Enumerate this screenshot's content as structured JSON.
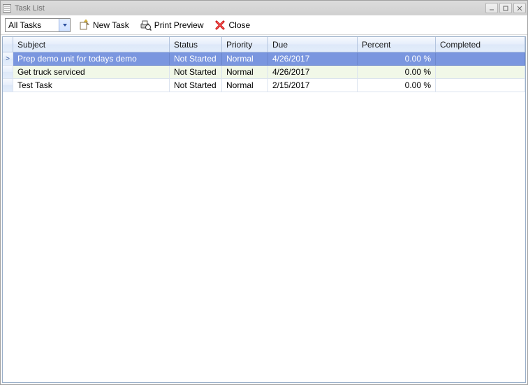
{
  "window": {
    "title": "Task List"
  },
  "toolbar": {
    "filter": "All Tasks",
    "new_task": "New Task",
    "print_preview": "Print Preview",
    "close": "Close"
  },
  "grid": {
    "columns": {
      "subject": "Subject",
      "status": "Status",
      "priority": "Priority",
      "due": "Due",
      "percent": "Percent",
      "completed": "Completed"
    },
    "rows": [
      {
        "indicator": ">",
        "subject": "Prep demo unit for todays demo",
        "status": "Not Started",
        "priority": "Normal",
        "due": "4/26/2017",
        "percent": "0.00 %",
        "completed": "",
        "selected": true
      },
      {
        "indicator": "",
        "subject": "Get truck serviced",
        "status": "Not Started",
        "priority": "Normal",
        "due": "4/26/2017",
        "percent": "0.00 %",
        "completed": "",
        "alt": true
      },
      {
        "indicator": "",
        "subject": "Test Task",
        "status": "Not Started",
        "priority": "Normal",
        "due": "2/15/2017",
        "percent": "0.00 %",
        "completed": ""
      }
    ]
  }
}
